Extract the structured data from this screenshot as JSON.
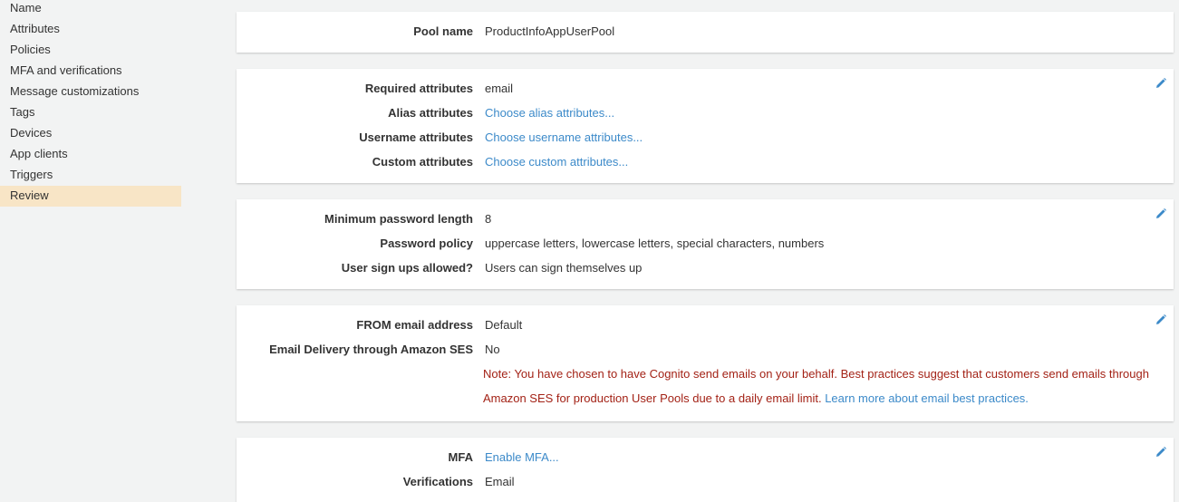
{
  "sidebar": {
    "items": [
      {
        "label": "Name"
      },
      {
        "label": "Attributes"
      },
      {
        "label": "Policies"
      },
      {
        "label": "MFA and verifications"
      },
      {
        "label": "Message customizations"
      },
      {
        "label": "Tags"
      },
      {
        "label": "Devices"
      },
      {
        "label": "App clients"
      },
      {
        "label": "Triggers"
      },
      {
        "label": "Review"
      }
    ],
    "active": "Review"
  },
  "pool": {
    "label": "Pool name",
    "value": "ProductInfoAppUserPool"
  },
  "attributes": {
    "required_label": "Required attributes",
    "required_value": "email",
    "alias_label": "Alias attributes",
    "alias_link": "Choose alias attributes...",
    "username_label": "Username attributes",
    "username_link": "Choose username attributes...",
    "custom_label": "Custom attributes",
    "custom_link": "Choose custom attributes..."
  },
  "policies": {
    "min_len_label": "Minimum password length",
    "min_len_value": "8",
    "policy_label": "Password policy",
    "policy_value": "uppercase letters, lowercase letters, special characters, numbers",
    "signup_label": "User sign ups allowed?",
    "signup_value": "Users can sign themselves up"
  },
  "email": {
    "from_label": "FROM email address",
    "from_value": "Default",
    "ses_label": "Email Delivery through Amazon SES",
    "ses_value": "No",
    "note_line1": "Note: You have chosen to have Cognito send emails on your behalf. Best practices suggest that customers send emails through",
    "note_line2": "Amazon SES for production User Pools due to a daily email limit.",
    "note_link": "Learn more about email best practices."
  },
  "mfa": {
    "mfa_label": "MFA",
    "mfa_link": "Enable MFA...",
    "verif_label": "Verifications",
    "verif_value": "Email"
  },
  "colors": {
    "accent_link": "#3c8ac9",
    "active_nav": "#f8e5c6",
    "warning": "#a32216",
    "page_bg": "#f2f3f3"
  },
  "icons": {
    "edit": "pencil-icon"
  }
}
